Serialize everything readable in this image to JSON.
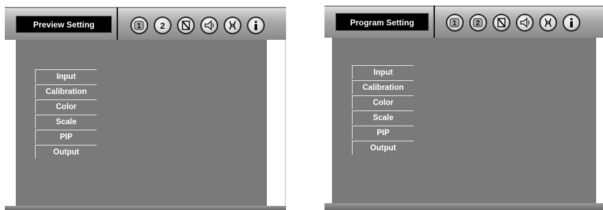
{
  "panels": [
    {
      "title": "Preview Setting",
      "icons": [
        "number-1-icon",
        "number-2-icon",
        "calibration-icon",
        "audio-speaker-icon",
        "tools-icon",
        "info-icon"
      ],
      "menu": [
        "Input",
        "Calibration",
        "Color",
        "Scale",
        "PIP",
        "Output"
      ]
    },
    {
      "title": "Program Setting",
      "icons": [
        "number-1-icon",
        "number-2-icon",
        "calibration-icon",
        "audio-speaker-icon",
        "tools-icon",
        "info-icon"
      ],
      "menu": [
        "Input",
        "Calibration",
        "Color",
        "Scale",
        "PIP",
        "Output"
      ]
    }
  ],
  "icon_glyphs": {
    "one": "1",
    "two": "2"
  },
  "colors": {
    "workspace": "#7a7a7a",
    "title_bg": "#000000",
    "title_text": "#ffffff"
  }
}
